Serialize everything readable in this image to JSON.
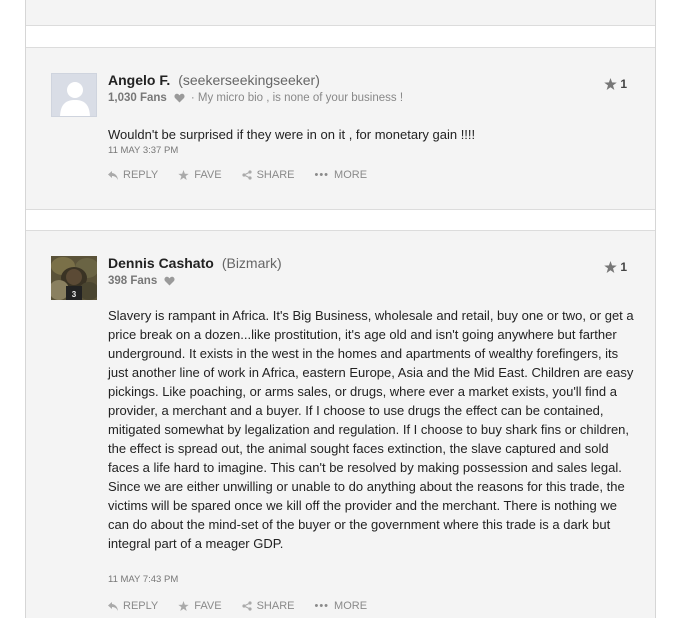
{
  "comments": [
    {
      "author": "Angelo F.",
      "handle": "(seekerseekingseeker)",
      "fans": "1,030 Fans",
      "bio": "My micro bio , is none of your business !",
      "score": "1",
      "body": "Wouldn't be surprised if they were in on it , for monetary gain !!!!",
      "timestamp": "11 MAY 3:37 PM"
    },
    {
      "author": "Dennis Cashato",
      "handle": "(Bizmark)",
      "fans": "398 Fans",
      "score": "1",
      "body": "Slavery is rampant in Africa. It's Big Business, wholesale and retail, buy one or two, or get a price break on a dozen...like prostitution, it's age old and isn't going anywhere but farther underground. It exists in the west in the homes and apartments of wealthy forefingers, its just another line of work in Africa, eastern Europe, Asia and the Mid East. Children are easy pickings. Like poaching, or arms sales, or drugs, where ever a market exists, you'll find a provider, a merchant and a buyer. If I choose to use drugs the effect can be contained, mitigated somewhat by legalization and regulation. If I choose to buy shark fins or children, the effect is spread out, the animal sought faces extinction, the slave captured and sold faces a life hard to imagine. This can't be resolved by making possession and sales legal. Since we are either unwilling or unable to do anything about the reasons for this trade, the victims will be spared once we kill off the provider and the merchant. There is nothing we can do about the mind-set of the buyer or the government where this trade is a dark but integral part of a meager GDP.",
      "timestamp": "11 MAY 7:43 PM"
    }
  ],
  "actions": {
    "reply": "REPLY",
    "fave": "FAVE",
    "share": "SHARE",
    "more": "MORE"
  },
  "icons": {
    "avatar_default": "person-silhouette-icon",
    "heart": "heart-icon",
    "star": "star-icon",
    "reply": "reply-arrow-icon",
    "share": "share-icon",
    "more": "ellipsis-icon"
  },
  "colors": {
    "panel_bg": "#f4f4f4",
    "text": "#222222",
    "muted": "#8a8a8a"
  }
}
